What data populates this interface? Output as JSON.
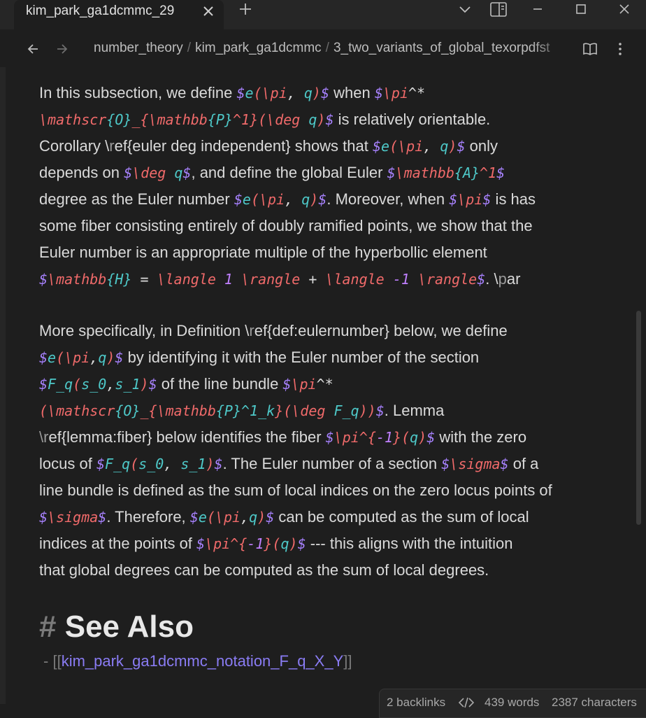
{
  "tab": {
    "title": "kim_park_ga1dcmmc_29"
  },
  "breadcrumb": [
    "number_theory",
    "kim_park_ga1dcmmc",
    "3_two_variants_of_global_texorpdfst"
  ],
  "paragraph1": {
    "l1": {
      "t1": "In this subsection, we define ",
      "d1": "$",
      "m1": "e",
      "m2": "(",
      "m3": "\\pi",
      "m4": ", ",
      "m5": "q",
      "m6": ")",
      "d2": "$",
      "t2": " when ",
      "d3": "$",
      "m7": "\\pi",
      "m8": "^*"
    },
    "l2": {
      "m1": "\\mathscr",
      "m2": "{O}",
      "m3": "_{",
      "m4": "\\mathbb",
      "m5": "{P}",
      "m6": "^1",
      "m7": "}(",
      "m8": "\\deg",
      "m9": " q",
      "m10": ")",
      "d1": "$",
      "t1": " is relatively orientable."
    },
    "l3": {
      "t1": "Corollary \\",
      "t2": "r",
      "t3": "ef{euler deg independent} shows that ",
      "d1": "$",
      "m1": "e",
      "m2": "(",
      "m3": "\\pi",
      "m4": ", ",
      "m5": "q",
      "m6": ")",
      "d2": "$",
      "t4": " only"
    },
    "l4": {
      "t1": "depends on ",
      "d1": "$",
      "m1": "\\deg",
      "m2": " q",
      "d2": "$",
      "t2": ", and define the global Euler ",
      "d3": "$",
      "m3": "\\mathbb",
      "m4": "{A}",
      "m5": "^1",
      "d4": "$"
    },
    "l5": {
      "t1": "degree as the Euler number ",
      "d1": "$",
      "m1": "e",
      "m2": "(",
      "m3": "\\pi",
      "m4": ", ",
      "m5": "q",
      "m6": ")",
      "d2": "$",
      "t2": ". Moreover, when ",
      "d3": "$",
      "m7": "\\pi",
      "d4": "$",
      "t3": " is has"
    },
    "l6": "some fiber consisting entirely of doubly ramified points, we show that the",
    "l7": "Euler number is an appropriate multiple of the hyperbollic element",
    "l8": {
      "d1": "$",
      "m1": "\\mathbb",
      "m2": "{H}",
      "m3": " = ",
      "m4": "\\langle",
      "m5": " 1 ",
      "m6": "\\rangle",
      "m7": " + ",
      "m8": "\\langle",
      "m9": " -1 ",
      "m10": "\\rangle",
      "d2": "$",
      "t1": ". \\",
      "t2": "p",
      "t3": "ar"
    }
  },
  "paragraph2": {
    "l1": {
      "t1": "More specifically, in Definition \\",
      "t2": "r",
      "t3": "ef{def:eulernumber} below, we define"
    },
    "l2": {
      "d1": "$",
      "m1": "e",
      "m2": "(",
      "m3": "\\pi",
      "m4": ",",
      "m5": "q",
      "m6": ")",
      "d2": "$",
      "t1": " by identifying it with the Euler number of the section"
    },
    "l3": {
      "d1": "$",
      "m1": "F_q",
      "m2": "(",
      "m3": "s_0",
      "m4": ",",
      "m5": "s_1",
      "m6": ")",
      "d2": "$",
      "t1": " of the line bundle ",
      "d3": "$",
      "m7": "\\pi",
      "m8": "^*"
    },
    "l4": {
      "m1": "(",
      "m2": "\\mathscr",
      "m3": "{O}",
      "m4": "_{",
      "m5": "\\mathbb",
      "m6": "{P}",
      "m7": "^1_k",
      "m8": "}(",
      "m9": "\\deg",
      "m10": " F_q",
      "m11": "))",
      "d1": "$",
      "t1": ". Lemma"
    },
    "l5": {
      "t1": "\\",
      "t2": "r",
      "t3": "ef{lemma:fiber} below identifies the fiber ",
      "d1": "$",
      "m1": "\\pi",
      "m2": "^{",
      "m3": "-1",
      "m4": "}(",
      "m5": "q",
      "m6": ")",
      "d2": "$",
      "t4": " with the zero"
    },
    "l6": {
      "t1": "locus of ",
      "d1": "$",
      "m1": "F_q",
      "m2": "(",
      "m3": "s_0",
      "m4": ", ",
      "m5": "s_1",
      "m6": ")",
      "d2": "$",
      "t2": ". The Euler number of a section ",
      "d3": "$",
      "m7": "\\sigma",
      "d4": "$",
      "t3": " of a"
    },
    "l7": "line bundle is defined as the sum of local indices on the zero locus points of",
    "l8": {
      "d1": "$",
      "m1": "\\sigma",
      "d2": "$",
      "t1": ". Therefore, ",
      "d3": "$",
      "m2": "e",
      "m3": "(",
      "m4": "\\pi",
      "m5": ",",
      "m6": "q",
      "m7": ")",
      "d4": "$",
      "t2": " can be computed as the sum of local"
    },
    "l9": {
      "t1": "indices at the points of ",
      "d1": "$",
      "m1": "\\pi",
      "m2": "^{",
      "m3": "-1",
      "m4": "}(",
      "m5": "q",
      "m6": ")",
      "d2": "$",
      "t2": " --- this aligns with the intuition"
    },
    "l10": "that global degrees can be computed as the sum of local degrees."
  },
  "heading": {
    "hash": "#",
    "text": "See Also"
  },
  "see_also": {
    "prefix": "- ",
    "open": "[[",
    "link": "kim_park_ga1dcmmc_notation_F_q_X_Y",
    "close": "]]"
  },
  "status_bar": {
    "backlinks": "2 backlinks",
    "words": "439 words",
    "characters": "2387 characters"
  },
  "icons": [
    "close-icon",
    "plus-icon",
    "chevron-down-icon",
    "sidebar-toggle-icon",
    "minimize-icon",
    "maximize-icon",
    "arrow-left-icon",
    "arrow-right-icon",
    "book-open-icon",
    "more-vertical-icon",
    "code-icon"
  ],
  "colors": {
    "background": "#1e1e1e",
    "text": "#dadada",
    "dollar": "#a882ff",
    "command": "#f06a6a",
    "variable": "#4ec9c9",
    "brace": "#5aa0ff",
    "number": "#c080ff",
    "link": "#8a7cf4"
  }
}
